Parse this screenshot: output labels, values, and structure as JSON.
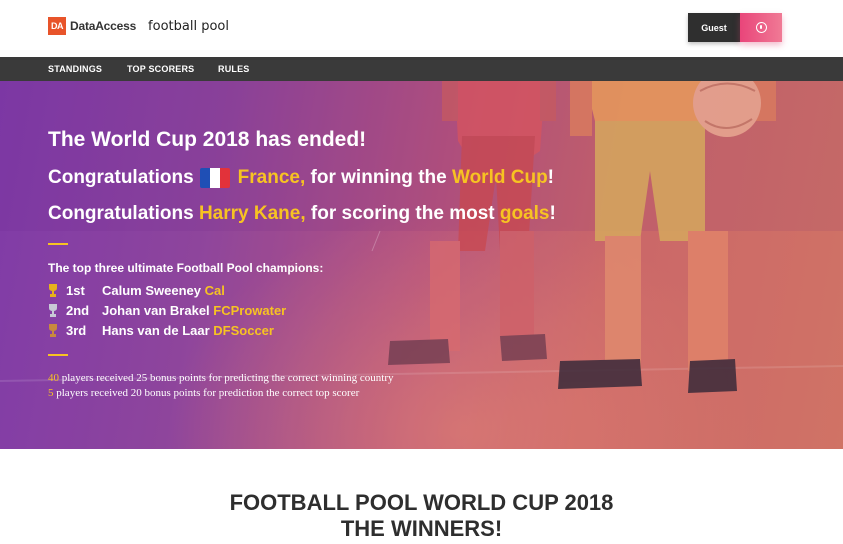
{
  "header": {
    "logo_mark": "DA",
    "logo_text": "DataAccess",
    "site_name": "football pool",
    "guest_label": "Guest"
  },
  "nav": {
    "items": [
      {
        "label": "STANDINGS"
      },
      {
        "label": "TOP SCORERS"
      },
      {
        "label": "RULES"
      }
    ]
  },
  "hero": {
    "headline": "The World Cup 2018 has ended!",
    "congrats_country": {
      "prefix": "Congratulations",
      "country": "France,",
      "middle": "for winning the",
      "event": "World Cup",
      "suffix": "!"
    },
    "congrats_scorer": {
      "prefix": "Congratulations",
      "player": "Harry Kane,",
      "middle": "for scoring the most",
      "highlight": "goals",
      "suffix": "!"
    },
    "champions_title": "The top three ultimate Football Pool champions:",
    "champions": [
      {
        "rank": "1st",
        "name": "Calum Sweeney",
        "team": "Cal",
        "medal": "gold"
      },
      {
        "rank": "2nd",
        "name": "Johan van Brakel",
        "team": "FCProwater",
        "medal": "silver"
      },
      {
        "rank": "3rd",
        "name": "Hans van de Laar",
        "team": "DFSoccer",
        "medal": "bronze"
      }
    ],
    "bonus": [
      {
        "count": "40",
        "text": "players received 25 bonus points for predicting the correct winning country"
      },
      {
        "count": "5",
        "text": "players received 20 bonus points for prediction the correct top scorer"
      }
    ]
  },
  "section": {
    "title_line1": "FOOTBALL POOL WORLD CUP 2018",
    "title_line2": "THE WINNERS!"
  },
  "colors": {
    "accent_yellow": "#f7c322",
    "brand_orange": "#e8542a",
    "nav_bg": "#3a3a3a",
    "user_button": "#e9457a"
  },
  "icons": [
    "user-icon",
    "trophy-icon",
    "france-flag"
  ]
}
